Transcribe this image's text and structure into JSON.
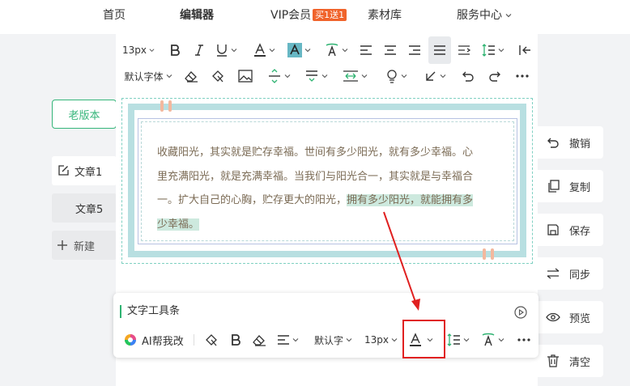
{
  "nav": {
    "home": "首页",
    "editor": "编辑器",
    "vip": "VIP会员",
    "vip_badge": "买1送1",
    "materials": "素材库",
    "service": "服务中心"
  },
  "toolbar": {
    "font_size": "13px",
    "font_family": "默认字体"
  },
  "left": {
    "old_version": "老版本",
    "article1": "文章1",
    "article5": "文章5",
    "new": "新建"
  },
  "right": {
    "undo": "撤销",
    "copy": "复制",
    "save": "保存",
    "sync": "同步",
    "preview": "预览",
    "clear": "清空"
  },
  "article": {
    "line1": "收藏阳光，其实就是贮存幸福。世间有多少阳光，就有多少幸福。心",
    "line2": "里充满阳光，就是充满幸福。当我们与阳光合一，其实就是与幸福合",
    "line3a": "一。扩大自己的心胸，贮存更大的阳光，",
    "line3b": "拥有多少阳光，就能拥有多",
    "line4": "少幸福。"
  },
  "float": {
    "title": "文字工具条",
    "ai": "AI帮我改",
    "font": "默认字",
    "size": "13px"
  },
  "colors": {
    "accent_green": "#35b57a",
    "highlight": "#cde9de",
    "annotation_red": "#e02020",
    "text_brown": "#7b6b55"
  }
}
